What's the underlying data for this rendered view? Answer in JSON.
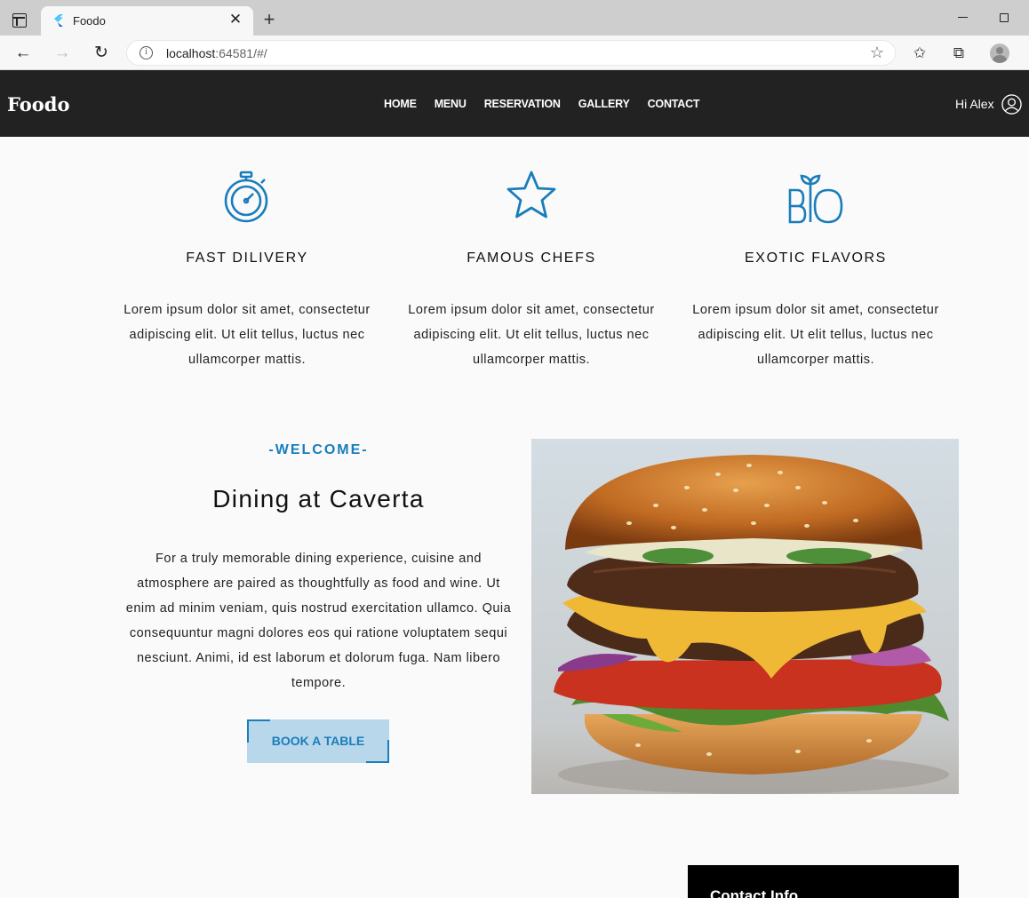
{
  "browser": {
    "tab_title": "Foodo",
    "url_host": "localhost",
    "url_rest": ":64581/#/",
    "new_tab_glyph": "+",
    "close_glyph": "✕"
  },
  "site": {
    "logo": "Foodo",
    "nav": [
      "HOME",
      "MENU",
      "RESERVATION",
      "GALLERY",
      "CONTACT"
    ],
    "greeting": "Hi Alex"
  },
  "features": [
    {
      "icon": "stopwatch-icon",
      "title": "FAST DILIVERY",
      "text": "Lorem ipsum dolor sit amet, consectetur adipiscing elit. Ut elit tellus, luctus nec ullamcorper mattis."
    },
    {
      "icon": "star-icon",
      "title": "FAMOUS CHEFS",
      "text": "Lorem ipsum dolor sit amet, consectetur adipiscing elit. Ut elit tellus, luctus nec ullamcorper mattis."
    },
    {
      "icon": "bio-icon",
      "title": "EXOTIC FLAVORS",
      "text": "Lorem ipsum dolor sit amet, consectetur adipiscing elit. Ut elit tellus, luctus nec ullamcorper mattis."
    }
  ],
  "welcome": {
    "eyebrow": "-WELCOME-",
    "title": "Dining at Caverta",
    "text": "For a truly memorable dining experience, cuisine and atmosphere are paired as thoughtfully as food and wine. Ut enim ad minim veniam, quis nostrud exercitation ullamco. Quia consequuntur magni dolores eos qui ratione voluptatem sequi nesciunt. Animi, id est laborum et dolorum fuga. Nam libero tempore.",
    "button": "BOOK A TABLE"
  },
  "contact": {
    "title": "Contact Info"
  },
  "colors": {
    "accent": "#1a7dbb",
    "header_bg": "#222222",
    "button_bg": "#b8d7ea"
  }
}
